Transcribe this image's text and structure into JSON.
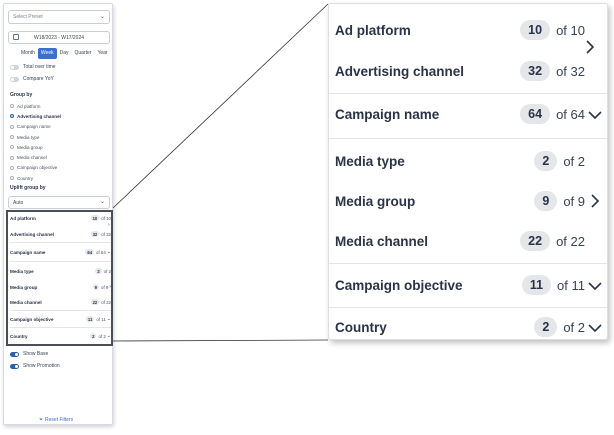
{
  "sidebar": {
    "preset_placeholder": "Select Preset",
    "date_range": "W18/2023 - W17/2024",
    "granularity": [
      "Month",
      "Week",
      "Day",
      "Quarter",
      "Year"
    ],
    "granularity_selected": "Week",
    "toggles": [
      {
        "label": "Total over time",
        "on": false
      },
      {
        "label": "Compare YoY",
        "on": false
      }
    ],
    "group_by_label": "Group by",
    "group_by_options": [
      "Ad platform",
      "Advertising channel",
      "Campaign name",
      "Media type",
      "Media group",
      "Media channel",
      "Campaign objective",
      "Country"
    ],
    "group_by_selected": "Advertising channel",
    "uplift_label": "Uplift group by",
    "uplift_value": "Auto",
    "bottom_toggles": [
      {
        "label": "Show Base",
        "on": true
      },
      {
        "label": "Show Promotion",
        "on": true
      }
    ],
    "reset_label": "Reset Filters"
  },
  "breakdown": [
    {
      "label": "Ad platform",
      "count": "10",
      "of": "of 10",
      "chevron": "right"
    },
    {
      "label": "Advertising channel",
      "count": "32",
      "of": "of 32",
      "chevron": "none"
    },
    {
      "label": "Campaign name",
      "count": "64",
      "of": "of 64",
      "chevron": "down"
    },
    {
      "label": "Media type",
      "count": "2",
      "of": "of 2",
      "chevron": "none"
    },
    {
      "label": "Media group",
      "count": "9",
      "of": "of 9",
      "chevron": "right"
    },
    {
      "label": "Media channel",
      "count": "22",
      "of": "of 22",
      "chevron": "none"
    },
    {
      "label": "Campaign objective",
      "count": "11",
      "of": "of 11",
      "chevron": "down"
    },
    {
      "label": "Country",
      "count": "2",
      "of": "of 2",
      "chevron": "down"
    }
  ],
  "colors": {
    "accent": "#3b6fcf",
    "toggle_on": "#2f5fb3",
    "badge_bg": "#e4e6ea",
    "text": "#2a3347"
  },
  "icons": {
    "calendar": "calendar-icon",
    "chevron_down": "chevron-down-icon",
    "chevron_right": "chevron-right-icon",
    "filter": "filter-icon"
  }
}
